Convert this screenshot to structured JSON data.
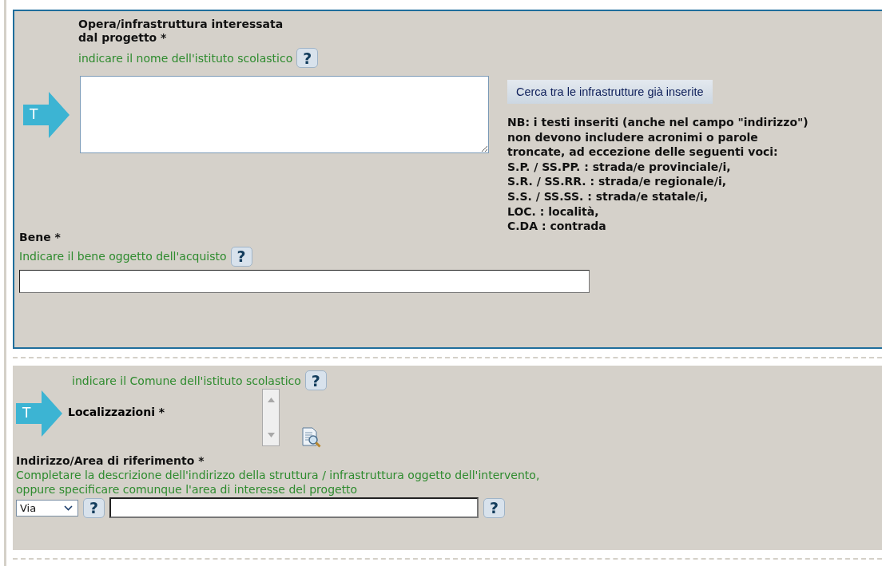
{
  "project_section": {
    "work_label_lines": [
      "Opera/infrastruttura interessata",
      "dal progetto *"
    ],
    "work_hint": "indicare il nome dell'istituto scolastico",
    "type_marker": "T",
    "search_button": "Cerca tra le infrastrutture già inserite",
    "note_lines": [
      "NB: i testi inseriti (anche nel campo \"indirizzo\")",
      "non devono includere acronimi o parole",
      "troncate, ad eccezione delle seguenti voci:",
      "S.P. / SS.PP. : strada/e provinciale/i,",
      "S.R. / SS.RR. : strada/e regionale/i,",
      "S.S. / SS.SS. : strada/e statale/i,",
      "LOC. : località,",
      "C.DA : contrada"
    ],
    "goods_label": "Bene *",
    "goods_hint": "Indicare il bene oggetto dell'acquisto",
    "help_glyph": "?"
  },
  "location_section": {
    "municipality_hint": "indicare il Comune dell'istituto scolastico",
    "type_marker": "T",
    "locations_label": "Localizzazioni *",
    "address_label": "Indirizzo/Area di riferimento *",
    "address_hint_lines": [
      "Completare la descrizione dell'indirizzo della struttura / infrastruttura oggetto dell'intervento,",
      "oppure specificare comunque l'area di interesse del progetto"
    ],
    "street_type": "Via",
    "help_glyph": "?"
  }
}
